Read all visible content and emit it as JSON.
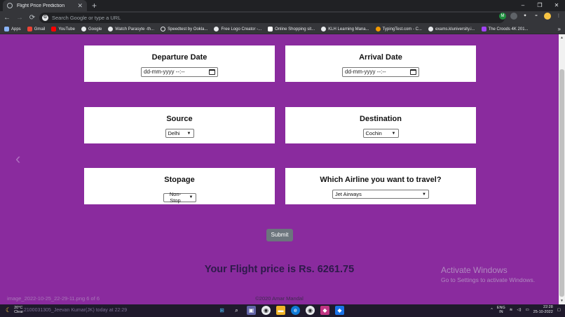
{
  "browser": {
    "tab_title": "Flight Price Prediction",
    "tab_close": "✕",
    "new_tab": "+",
    "window_controls": [
      "–",
      "❐",
      "✕"
    ],
    "nav": {
      "back": "←",
      "forward": "→",
      "reload": "⟳"
    },
    "omnibox_placeholder": "Search Google or type a URL",
    "omnibox_icon": "G",
    "extensions": [
      "M",
      "",
      "✦",
      "=",
      ""
    ],
    "bookmarks": [
      {
        "label": "Apps",
        "color": "#5f6368"
      },
      {
        "label": "Gmail",
        "color": "#ea4335"
      },
      {
        "label": "YouTube",
        "color": "#ff0000"
      },
      {
        "label": "Google",
        "color": "#e8eaed"
      },
      {
        "label": "Watch Parasyte -th...",
        "color": "#e8eaed"
      },
      {
        "label": "Speedtest by Ookla...",
        "color": "#e8eaed"
      },
      {
        "label": "Free Logo Creator -...",
        "color": "#e8eaed"
      },
      {
        "label": "Online Shopping sit...",
        "color": "#e8eaed"
      },
      {
        "label": "KLH Learning Mana...",
        "color": "#e8eaed"
      },
      {
        "label": "TypingTest.com - C...",
        "color": "#f29900"
      },
      {
        "label": "exams.kluniversity.i...",
        "color": "#e8eaed"
      },
      {
        "label": "The Croods 4K 201...",
        "color": "#a142f4"
      }
    ],
    "bookmarks_more": "»"
  },
  "form": {
    "departure": {
      "label": "Departure Date",
      "placeholder": "dd-mm-yyyy --:--"
    },
    "arrival": {
      "label": "Arrival Date",
      "placeholder": "dd-mm-yyyy --:--"
    },
    "source": {
      "label": "Source",
      "value": "Delhi"
    },
    "destination": {
      "label": "Destination",
      "value": "Cochin"
    },
    "stopage": {
      "label": "Stopage",
      "value": "Non-Stop"
    },
    "airline": {
      "label": "Which Airline you want to travel?",
      "value": "Jet Airways"
    },
    "submit_label": "Submit",
    "carousel_prev": "‹"
  },
  "result_text": "Your Flight price is Rs. 6261.75",
  "footer_text": "©2020 Amar Mandal",
  "download_text": "image_2022-10-25_22-29-11.png 6 of 6",
  "windows_watermark": {
    "title": "Activate Windows",
    "subtitle": "Go to Settings to activate Windows."
  },
  "taskbar": {
    "weather_temp": "20°C",
    "weather_desc": "Clear",
    "notification": "2100031305_Jeevan Kumar(JK)  today at 22:29",
    "lang_1": "ENG",
    "lang_2": "IN",
    "time": "22:28",
    "date": "25-10-2022",
    "tray_arrow": "^"
  }
}
